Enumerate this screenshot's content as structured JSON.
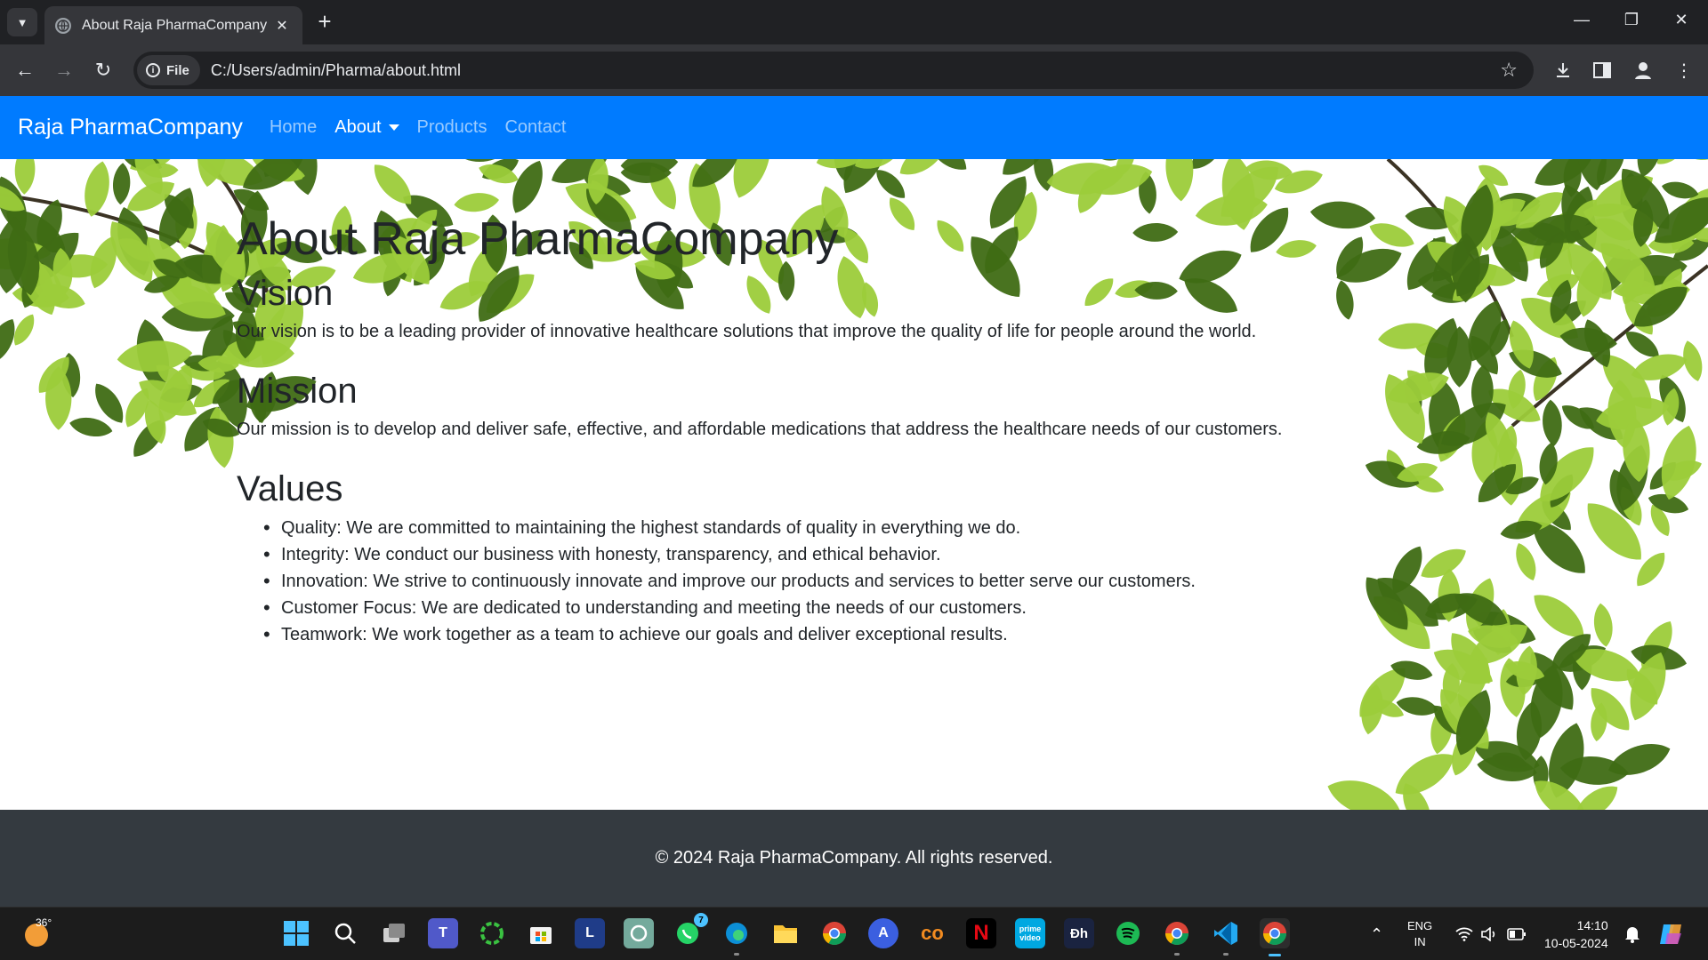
{
  "browser": {
    "tab_title": "About Raja PharmaCompany",
    "site_chip": "File",
    "url": "C:/Users/admin/Pharma/about.html"
  },
  "site": {
    "brand": "Raja PharmaCompany",
    "nav": [
      "Home",
      "About",
      "Products",
      "Contact"
    ],
    "active_nav": "About"
  },
  "page": {
    "title": "About Raja PharmaCompany",
    "vision_heading": "Vision",
    "vision_text": "Our vision is to be a leading provider of innovative healthcare solutions that improve the quality of life for people around the world.",
    "mission_heading": "Mission",
    "mission_text": "Our mission is to develop and deliver safe, effective, and affordable medications that address the healthcare needs of our customers.",
    "values_heading": "Values",
    "values": [
      "Quality: We are committed to maintaining the highest standards of quality in everything we do.",
      "Integrity: We conduct our business with honesty, transparency, and ethical behavior.",
      "Innovation: We strive to continuously innovate and improve our products and services to better serve our customers.",
      "Customer Focus: We are dedicated to understanding and meeting the needs of our customers.",
      "Teamwork: We work together as a team to achieve our goals and deliver exceptional results."
    ]
  },
  "footer": {
    "text": "© 2024 Raja PharmaCompany. All rights reserved."
  },
  "taskbar": {
    "weather_temp": "36°",
    "whatsapp_badge": "7",
    "lang_line1": "ENG",
    "lang_line2": "IN",
    "time": "14:10",
    "date": "10-05-2024",
    "apps": [
      "start",
      "search",
      "task-view",
      "teams",
      "app-ring",
      "store",
      "l-app",
      "chatgpt",
      "whatsapp",
      "edge",
      "file-explorer",
      "chrome",
      "arc",
      "coursera",
      "netflix",
      "prime-video",
      "dh",
      "spotify",
      "chrome-profile",
      "vscode",
      "chrome-active"
    ]
  },
  "colors": {
    "navbar": "#007bff",
    "footer": "#343a40",
    "leaf_dark": "#3f6b14",
    "leaf_light": "#9ccc3a"
  }
}
